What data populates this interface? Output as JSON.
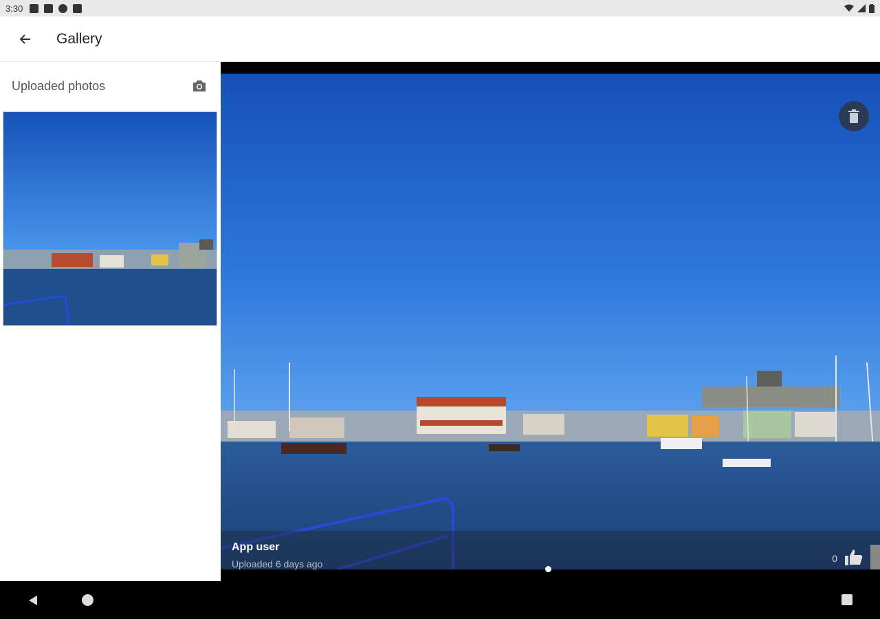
{
  "status_bar": {
    "time": "3:30"
  },
  "app_bar": {
    "title": "Gallery"
  },
  "left_pane": {
    "title": "Uploaded photos"
  },
  "viewer": {
    "user": "App user",
    "uploaded": "Uploaded 6 days ago",
    "likes": "0",
    "pager_total": 1,
    "pager_active": 1
  },
  "icons": {
    "back": "arrow-back-icon",
    "camera": "camera-icon",
    "delete": "trash-icon",
    "like": "thumb-up-icon"
  },
  "colors": {
    "delete_button_bg": "#2a3a55",
    "sky": "#1e6ad8",
    "water": "#1b4b8a"
  }
}
